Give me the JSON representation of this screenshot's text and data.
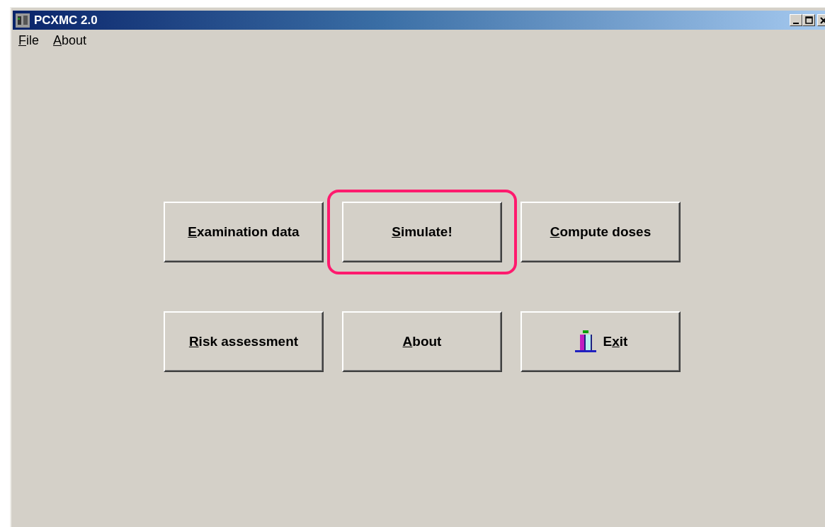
{
  "window": {
    "title": "PCXMC 2.0",
    "controls": [
      {
        "kind": "minimize"
      },
      {
        "kind": "maximize"
      },
      {
        "kind": "close"
      }
    ]
  },
  "menu": [
    {
      "key": "F",
      "after": "ile"
    },
    {
      "key": "A",
      "after": "bout"
    }
  ],
  "buttons": [
    {
      "key": "E",
      "after": "xamination data",
      "highlighted": false,
      "kind": "text"
    },
    {
      "key": "S",
      "after": "imulate!",
      "highlighted": true,
      "kind": "text"
    },
    {
      "key": "C",
      "after": "ompute doses",
      "highlighted": false,
      "kind": "text"
    },
    {
      "key": "R",
      "after": "isk assessment",
      "highlighted": false,
      "kind": "text"
    },
    {
      "key": "A",
      "after": "bout",
      "highlighted": false,
      "kind": "text"
    },
    {
      "before": "E",
      "key": "x",
      "after": "it",
      "highlighted": false,
      "kind": "exit"
    }
  ]
}
